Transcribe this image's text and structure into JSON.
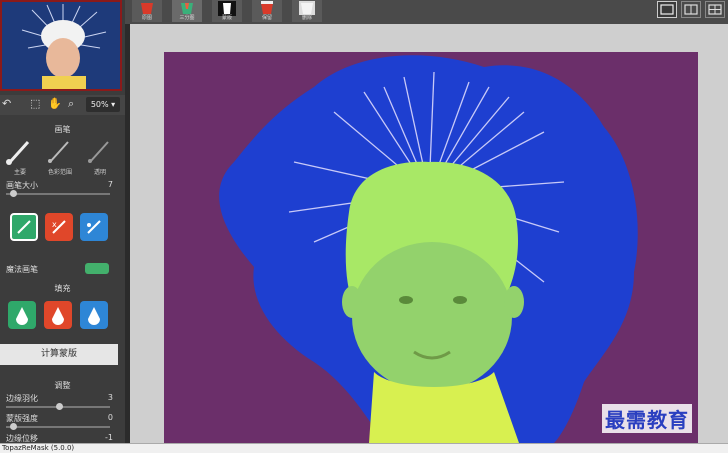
{
  "app": {
    "status_title": "TopazReMask (5.0.0)"
  },
  "toolbar": {
    "tabs": [
      {
        "label": "原图"
      },
      {
        "label": "三分图"
      },
      {
        "label": "蒙版"
      },
      {
        "label": "保留"
      },
      {
        "label": "删除"
      }
    ]
  },
  "tools": {
    "zoom": "50% ▾"
  },
  "brush_panel": {
    "title": "画笔",
    "brushes": [
      {
        "label": "主要"
      },
      {
        "label": "色彩范围"
      },
      {
        "label": "透明"
      }
    ],
    "size_label": "画笔大小",
    "size_value": "7",
    "magic_label": "魔法画笔"
  },
  "fill_panel": {
    "title": "填充"
  },
  "compute_button": "计算蒙版",
  "adjust_panel": {
    "title": "调整",
    "rows": [
      {
        "label": "边缘羽化",
        "value": "3"
      },
      {
        "label": "蒙版强度",
        "value": "0"
      },
      {
        "label": "边缘位移",
        "value": "-1"
      }
    ]
  },
  "watermark": "最需教育",
  "colors": {
    "keep": "#2fa86a",
    "drop": "#e0472a",
    "blue": "#2e86d6",
    "mask_blue": "#1e3fd0",
    "bg_purple": "#6b2f6a"
  }
}
